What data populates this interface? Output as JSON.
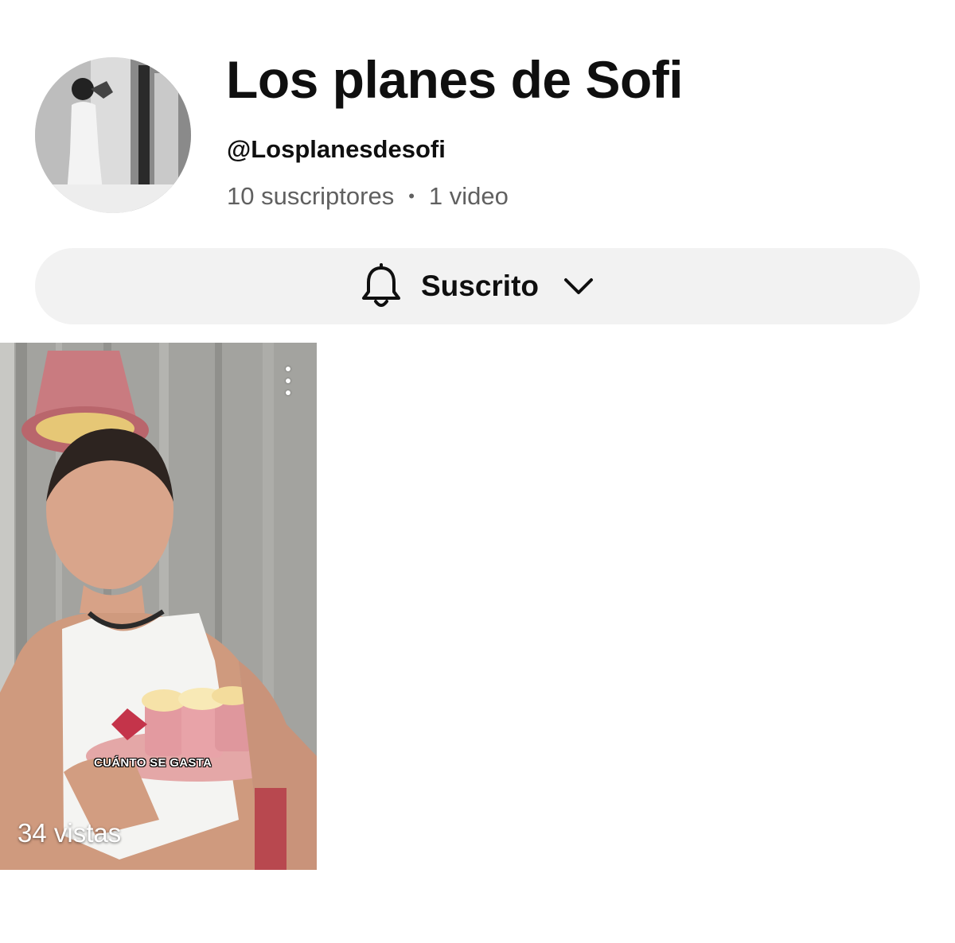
{
  "channel": {
    "name": "Los planes de Sofi",
    "handle": "@Losplanesdesofi",
    "subscribers": "10 suscriptores",
    "separator": "•",
    "video_count": "1 video"
  },
  "subscribe_button": {
    "label": "Suscrito",
    "icon": "bell-icon",
    "dropdown_icon": "chevron-down-icon"
  },
  "videos": [
    {
      "caption": "CUÁNTO SE GASTA",
      "views": "34 vistas",
      "menu_icon": "more-vert-icon"
    }
  ]
}
